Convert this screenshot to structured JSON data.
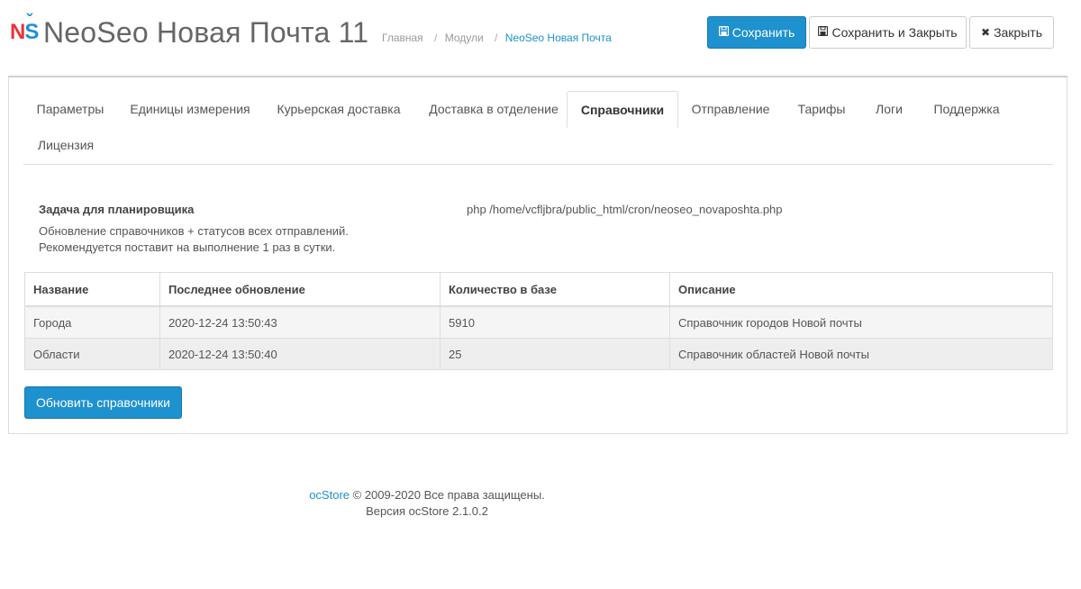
{
  "header": {
    "logo_n": "N",
    "logo_s": "S",
    "title": "NeoSeo Новая Почта 11",
    "breadcrumb": [
      "Главная",
      "Модули",
      "NeoSeo Новая Почта"
    ],
    "separator": "/"
  },
  "actions": {
    "save_label": "Сохранить",
    "save_close_label": "Сохранить и Закрыть",
    "close_label": "Закрыть",
    "save_icon": "floppy-disk-icon",
    "close_icon": "times-icon"
  },
  "tabs": [
    "Параметры",
    "Единицы измерения",
    "Курьерская доставка",
    "Доставка в отделение",
    "Справочники",
    "Отправление",
    "Тарифы",
    "Логи",
    "Поддержка",
    "Лицензия"
  ],
  "active_tab": "Справочники",
  "task": {
    "title": "Задача для планировщика",
    "desc_line1": "Обновление справочников + статусов всех отправлений.",
    "desc_line2": "Рекомендуется поставит на выполнение 1 раз в сутки.",
    "command": "php /home/vcfljbra/public_html/cron/neoseo_novaposhta.php"
  },
  "table": {
    "headers": [
      "Название",
      "Последнее обновление",
      "Количество в базе",
      "Описание"
    ],
    "rows": [
      [
        "Города",
        "2020-12-24 13:50:43",
        "5910",
        "Справочник городов Новой почты"
      ],
      [
        "Области",
        "2020-12-24 13:50:40",
        "25",
        "Справочник областей Новой почты"
      ]
    ]
  },
  "update_button": "Обновить справочники",
  "footer": {
    "brand": "ocStore",
    "copyright": "© 2009-2020 Все права защищены.",
    "version": "Версия ocStore 2.1.0.2"
  },
  "colors": {
    "primary": "#1e91cf",
    "logo_red": "#e8343a",
    "logo_blue": "#1f8fd9"
  }
}
